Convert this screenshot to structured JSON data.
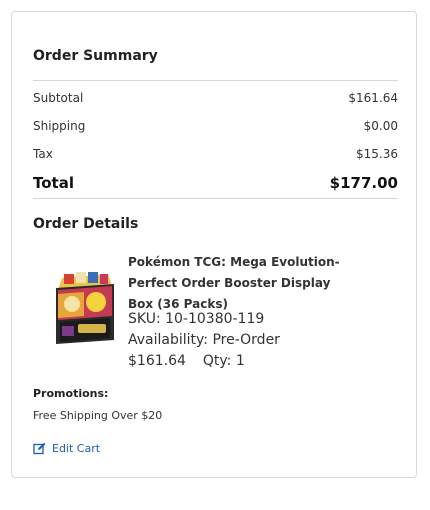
{
  "summary": {
    "title": "Order Summary",
    "rows": [
      {
        "label": "Subtotal",
        "value": "$161.64"
      },
      {
        "label": "Shipping",
        "value": "$0.00"
      },
      {
        "label": "Tax",
        "value": "$15.36"
      }
    ],
    "total": {
      "label": "Total",
      "value": "$177.00"
    }
  },
  "details": {
    "title": "Order Details",
    "product": {
      "name": "Pokémon TCG: Mega Evolution-Perfect Order Booster Display Box (36 Packs)",
      "sku": "SKU: 10-10380-119",
      "availability": "Availability: Pre-Order",
      "price": "$161.64",
      "qty": "Qty: 1"
    },
    "promotions_label": "Promotions:",
    "promotion": "Free Shipping Over $20",
    "edit_cart": "Edit Cart"
  },
  "colors": {
    "link": "#1a5fae",
    "border": "#d9d9d9",
    "divider": "#d6d6d6"
  },
  "icons": {
    "edit_cart": "edit-icon",
    "product": "booster-display-box-image"
  }
}
